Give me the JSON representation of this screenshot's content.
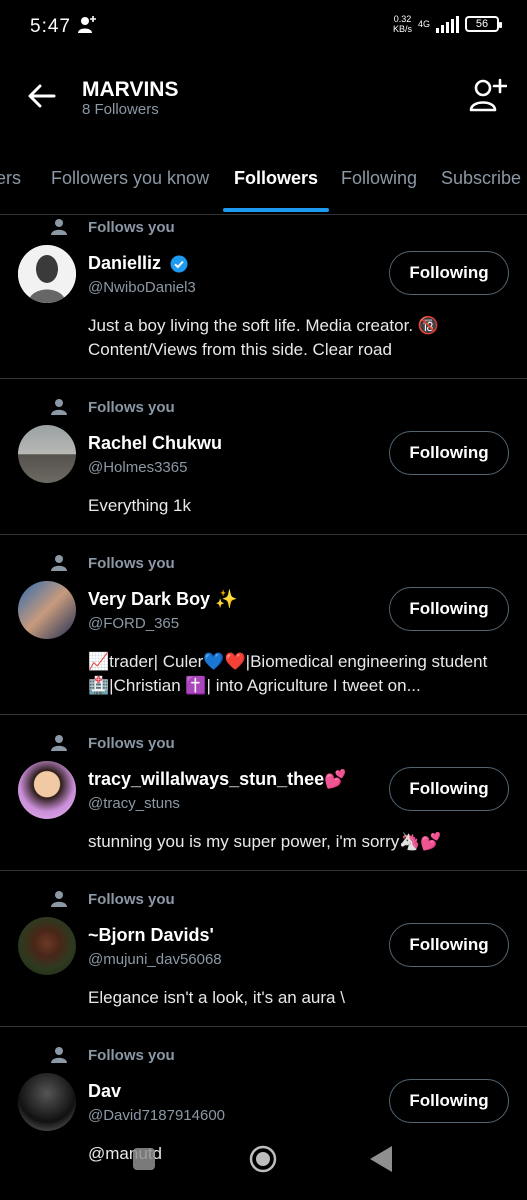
{
  "status_bar": {
    "time": "5:47",
    "net_speed_top": "0.32",
    "net_speed_unit": "KB/s",
    "lte": "4G",
    "battery": "56"
  },
  "header": {
    "title": "MARVINS",
    "subtitle": "8 Followers",
    "back_icon": "arrow-left-icon",
    "action_icon": "add-user-icon"
  },
  "tabs": [
    {
      "label": "ers"
    },
    {
      "label": "Followers you know"
    },
    {
      "label": "Followers",
      "active": true
    },
    {
      "label": "Following"
    },
    {
      "label": "Subscribe"
    }
  ],
  "followers": [
    {
      "follows_you": "Follows you",
      "name": "Danielliz",
      "verified": true,
      "handle": "@NwiboDaniel3",
      "button": "Following",
      "bio": "Just a boy living the soft life. Media creator. 🔞 Content/Views from this side. Clear road"
    },
    {
      "follows_you": "Follows you",
      "name": "Rachel Chukwu",
      "handle": "@Holmes3365",
      "button": "Following",
      "bio": "Everything 1k"
    },
    {
      "follows_you": "Follows you",
      "name": "Very Dark Boy ✨",
      "handle": "@FORD_365",
      "button": "Following",
      "bio": "📈trader| Culer💙❤️|Biomedical engineering student 🏥|Christian ✝️| into Agriculture I tweet on..."
    },
    {
      "follows_you": "Follows you",
      "name": "tracy_willalways_stun_thee💕",
      "handle": "@tracy_stuns",
      "button": "Following",
      "bio": "stunning you is my super power, i'm sorry🦄💕"
    },
    {
      "follows_you": "Follows you",
      "name": "~Bjorn Davids'",
      "handle": "@mujuni_dav56068",
      "button": "Following",
      "bio": "Elegance isn't a look, it's an aura \\"
    },
    {
      "follows_you": "Follows you",
      "name": "Dav",
      "handle": "@David7187914600",
      "button": "Following",
      "bio": "@manutd"
    }
  ],
  "colors": {
    "accent": "#1d9bf0",
    "muted": "#8b98a5",
    "divider": "#2f3336"
  }
}
